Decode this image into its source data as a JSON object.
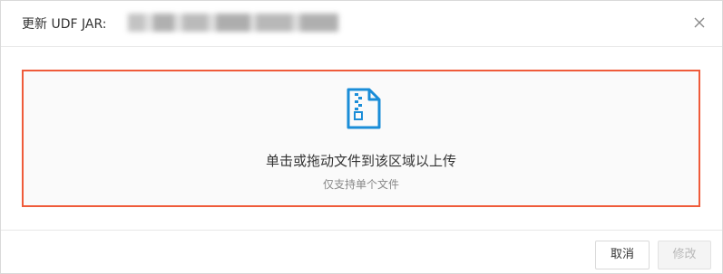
{
  "dialog": {
    "title_prefix": "更新 UDF JAR:",
    "title_filename_redacted": true
  },
  "icons": {
    "close": "close-icon",
    "file": "zip-file-icon"
  },
  "upload": {
    "main_text": "单击或拖动文件到该区域以上传",
    "sub_text": "仅支持单个文件",
    "highlight_color": "#ef5b3a",
    "icon_color": "#1a8dd8"
  },
  "footer": {
    "cancel_label": "取消",
    "submit_label": "修改",
    "submit_disabled": true
  }
}
